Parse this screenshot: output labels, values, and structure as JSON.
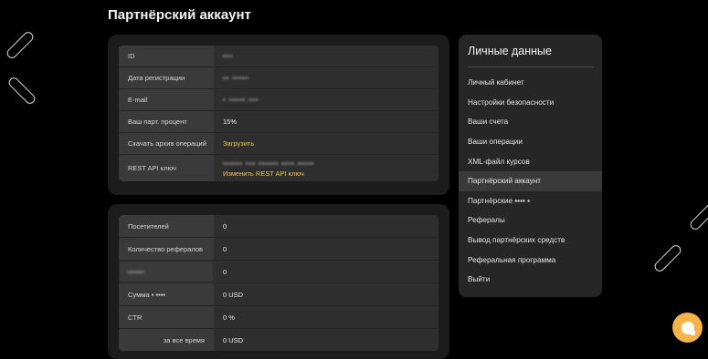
{
  "page": {
    "title": "Партнёрский аккаунт"
  },
  "account": {
    "rows": [
      {
        "label": "ID",
        "value": "▪▪▪"
      },
      {
        "label": "Дата регистрации",
        "value": "▪▪ ▪▪▪▪▪"
      },
      {
        "label": "E-mail",
        "value": "▪ ▪▪▪▪▪ ▪▪▪"
      },
      {
        "label": "Ваш парт. процент",
        "value": "15%"
      },
      {
        "label": "Скачать архив операций",
        "value": "Загрузить"
      },
      {
        "label": "REST API ключ",
        "value": "▪▪▪▪▪▪ ▪▪▪ ▪▪▪▪▪▪ ▪▪▪▪ ▪▪▪▪▪",
        "action": "Изменить REST API ключ"
      }
    ]
  },
  "stats": {
    "rows": [
      {
        "label": "Посетителей",
        "value": "0"
      },
      {
        "label": "Количество рефералов",
        "value": "0"
      },
      {
        "label": "▪▪▪▪▪",
        "value": "0"
      },
      {
        "label": "Сумма ▪ ▪▪▪▪",
        "value": "0 USD"
      },
      {
        "label": "CTR",
        "value": "0 %"
      },
      {
        "label": "за все время",
        "value": "0 USD"
      }
    ]
  },
  "sidebar": {
    "title": "Личные данные",
    "items": [
      {
        "label": "Личный кабинет"
      },
      {
        "label": "Настройки безопасности"
      },
      {
        "label": "Ваши счета"
      },
      {
        "label": "Ваши операции"
      },
      {
        "label": "XML-файл курсов"
      },
      {
        "label": "Партнёрский аккаунт"
      },
      {
        "label": "Партнёрские ▪▪▪▪ ▪"
      },
      {
        "label": "Рефералы"
      },
      {
        "label": "Вывод партнёрских средств"
      },
      {
        "label": "Реферальная программа"
      },
      {
        "label": "Выйти"
      }
    ]
  },
  "colors": {
    "accent": "#f1c34a",
    "chat": "#f6b347"
  }
}
